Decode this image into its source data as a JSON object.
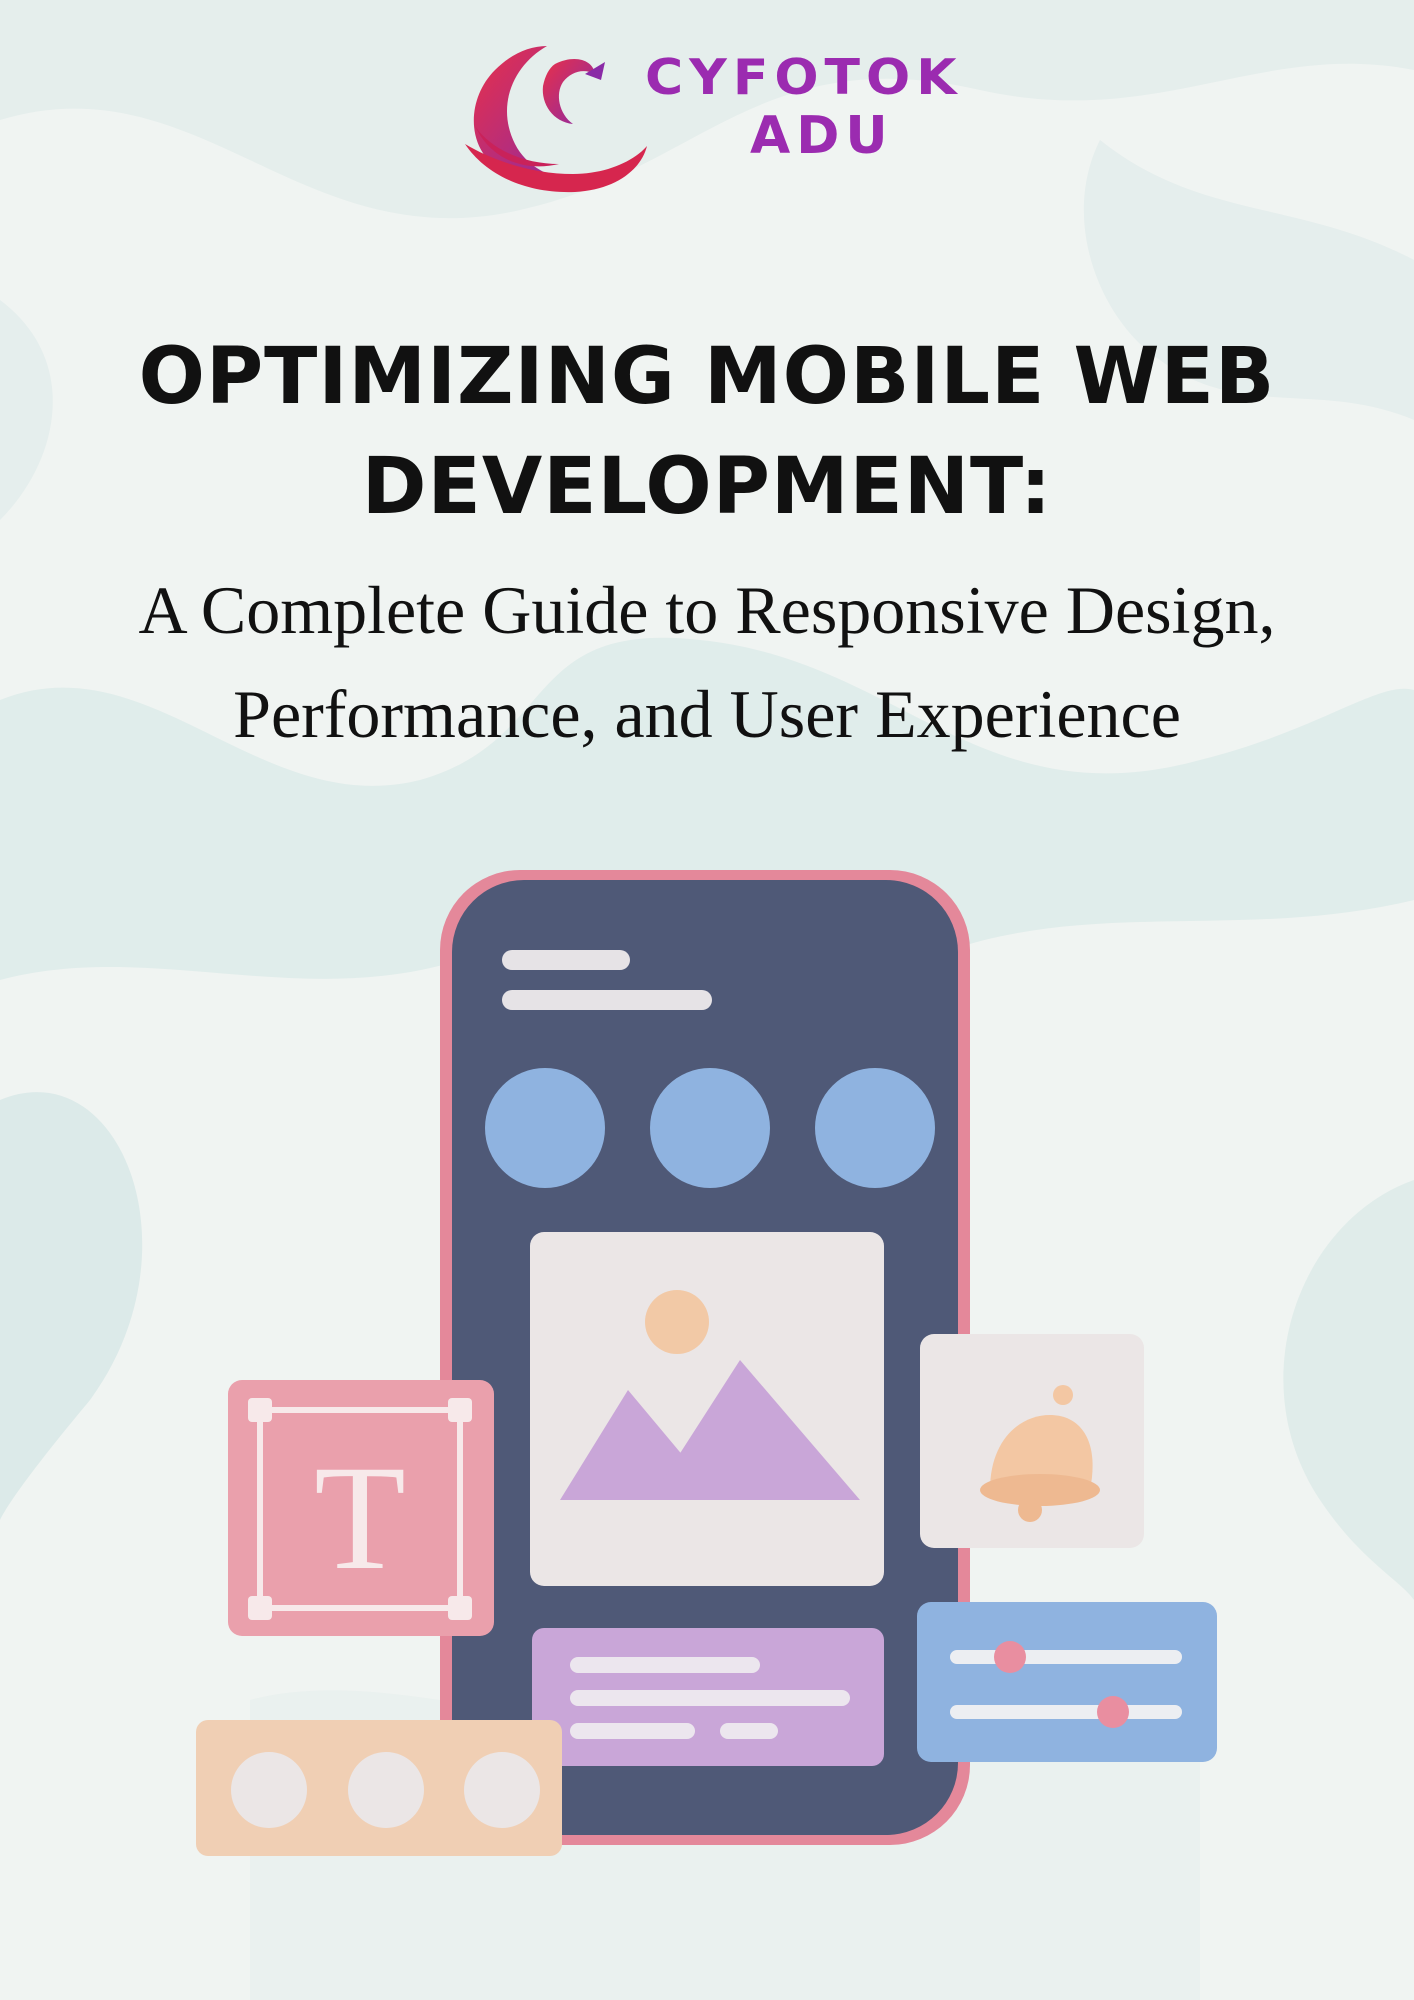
{
  "brand": {
    "line1": "CYFOTOK",
    "line2": "ADU",
    "color": "#9b2bb0"
  },
  "title": {
    "line1": "OPTIMIZING MOBILE WEB",
    "line2": "DEVELOPMENT:"
  },
  "subtitle": {
    "line1": "A Complete Guide to Responsive Design,",
    "line2": "Performance, and User Experience"
  },
  "illustration": {
    "text_tool_glyph": "T",
    "icons": [
      "phone-mockup",
      "image-icon",
      "bell-icon",
      "text-tool-icon",
      "slider-panel",
      "dots-panel"
    ]
  },
  "colors": {
    "phone_body": "#4f5977",
    "phone_rim": "#e4889a",
    "circle_blue": "#8fb3e0",
    "card_pink": "#eaa0ac",
    "card_peach": "#f0cfb4",
    "card_lilac": "#c9a6d8",
    "card_light": "#ebe6e6"
  }
}
